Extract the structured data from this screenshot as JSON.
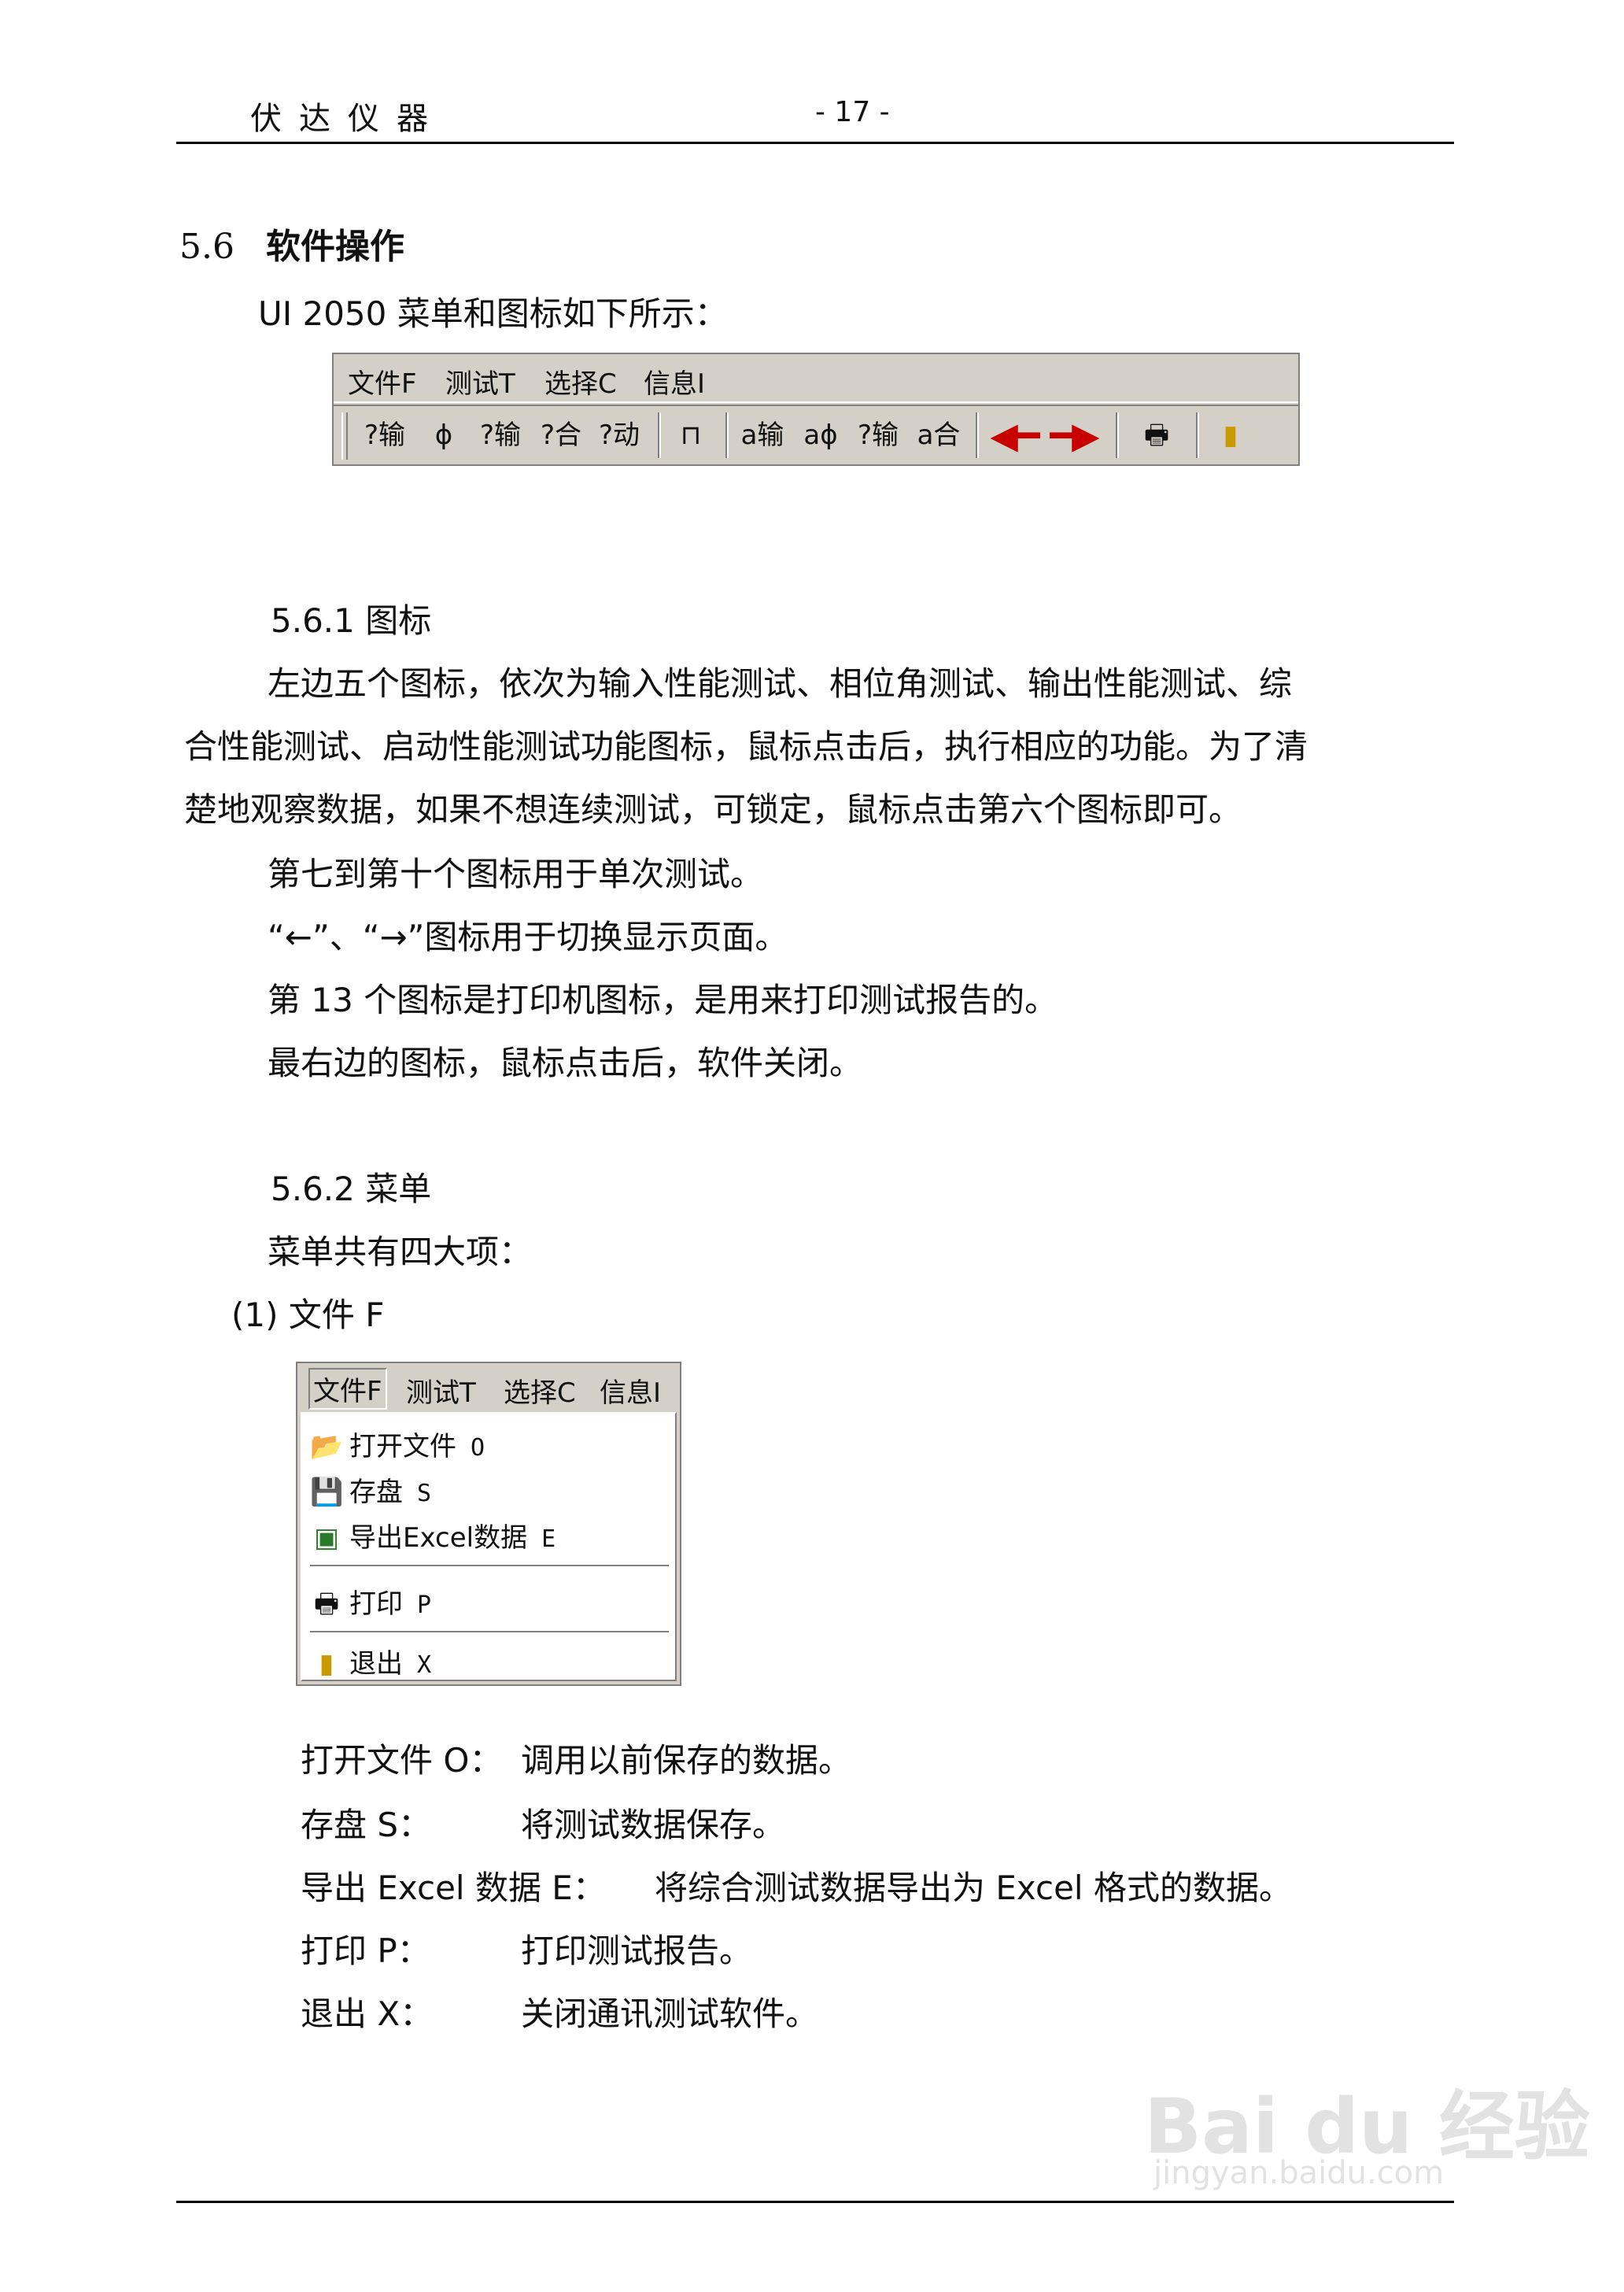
{
  "header": {
    "company": "伏达仪器",
    "page": "- 17 -"
  },
  "section": {
    "number": "5.6",
    "title": "软件操作",
    "intro": "UI 2050 菜单和图标如下所示："
  },
  "toolbar": {
    "menus": [
      "文件F",
      "测试T",
      "选择C",
      "信息I"
    ],
    "icons": [
      {
        "name": "input-test-icon",
        "label": "?输"
      },
      {
        "name": "phase-angle-test-icon",
        "label": "ɸ"
      },
      {
        "name": "output-test-icon",
        "label": "?输"
      },
      {
        "name": "combined-test-icon",
        "label": "?合"
      },
      {
        "name": "startup-test-icon",
        "label": "?动"
      },
      {
        "name": "lock-icon",
        "label": "⊓"
      },
      {
        "name": "single-input-test-icon",
        "label": "a输"
      },
      {
        "name": "single-phase-test-icon",
        "label": "aɸ"
      },
      {
        "name": "single-output-test-icon",
        "label": "?输"
      },
      {
        "name": "single-combined-test-icon",
        "label": "a合"
      },
      {
        "name": "arrow-left-icon",
        "label": "◀━"
      },
      {
        "name": "arrow-right-icon",
        "label": "━▶"
      },
      {
        "name": "printer-icon",
        "label": "🖶"
      },
      {
        "name": "exit-door-icon",
        "label": "▮"
      }
    ]
  },
  "sub1": {
    "heading": "5.6.1 图标",
    "lines": [
      "左边五个图标，依次为输入性能测试、相位角测试、输出性能测试、综",
      "合性能测试、启动性能测试功能图标，鼠标点击后，执行相应的功能。为了清",
      "楚地观察数据，如果不想连续测试，可锁定，鼠标点击第六个图标即可。",
      "第七到第十个图标用于单次测试。",
      "“←”、“→”图标用于切换显示页面。",
      "第 13 个图标是打印机图标，是用来打印测试报告的。",
      "最右边的图标，鼠标点击后，软件关闭。"
    ]
  },
  "sub2": {
    "heading": "5.6.2 菜单",
    "intro": "菜单共有四大项：",
    "item1": "(1)  文件 F"
  },
  "dropdown": {
    "bar": [
      "文件F",
      "测试T",
      "选择C",
      "信息I"
    ],
    "items": [
      {
        "label": "打开文件",
        "shortcut": "O"
      },
      {
        "label": "存盘",
        "shortcut": "S"
      },
      {
        "label": "导出Excel数据",
        "shortcut": "E"
      },
      {
        "label": "打印",
        "shortcut": "P"
      },
      {
        "label": "退出",
        "shortcut": "X"
      }
    ]
  },
  "descriptions": [
    {
      "term": "打开文件 O：",
      "desc": "调用以前保存的数据。"
    },
    {
      "term": "存盘 S：",
      "desc": "将测试数据保存。"
    },
    {
      "term": "导出 Excel  数据  E：",
      "desc": "将综合测试数据导出为 Excel  格式的数据。"
    },
    {
      "term": "打印 P：",
      "desc": "打印测试报告。"
    },
    {
      "term": "退出 X：",
      "desc": "关闭通讯测试软件。"
    }
  ],
  "watermark": {
    "brand": "Bai du 经验",
    "url": "jingyan.baidu.com"
  }
}
